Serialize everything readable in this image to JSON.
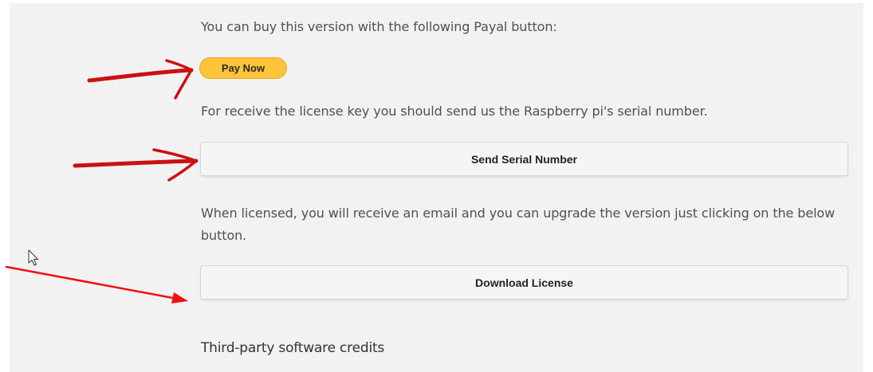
{
  "content": {
    "buy_text": "You can buy this version with the following Payal button:",
    "pay_button_label": "Pay Now",
    "license_text": "For receive the license key you should send us the Raspberry pi's serial number.",
    "send_serial_label": "Send Serial Number",
    "licensed_text": "When licensed, you will receive an email and you can upgrade the version just clicking on the below button.",
    "download_license_label": "Download License",
    "credits_heading": "Third-party software credits"
  },
  "colors": {
    "pay_button": "#ffc439",
    "annotation_arrow": "#cc1111"
  },
  "icons": {
    "cursor": "mouse-pointer-icon"
  }
}
